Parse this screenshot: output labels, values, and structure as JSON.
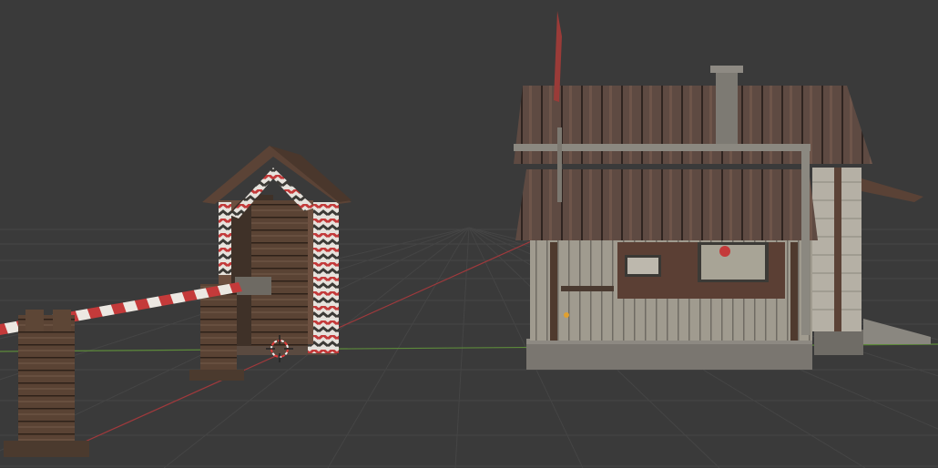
{
  "viewport": {
    "view": "3D Viewport",
    "background_color": "#3a3a3a",
    "grid_color": "#454545",
    "x_axis_color": "#a0393c",
    "y_axis_color": "#5d8a3a"
  },
  "scene": {
    "objects": [
      {
        "name": "sentry-box",
        "colors": [
          "#6b4a33",
          "#c23a3a",
          "#e8e8e8"
        ]
      },
      {
        "name": "barrier-gate",
        "colors": [
          "#c23a3a",
          "#e8e8e8",
          "#5a4030"
        ]
      },
      {
        "name": "guard-house",
        "colors": [
          "#5c4a40",
          "#9a958a",
          "#7a7670"
        ]
      }
    ],
    "cursor": "3d-cursor-icon",
    "origin_marker": "object-origin-icon"
  }
}
